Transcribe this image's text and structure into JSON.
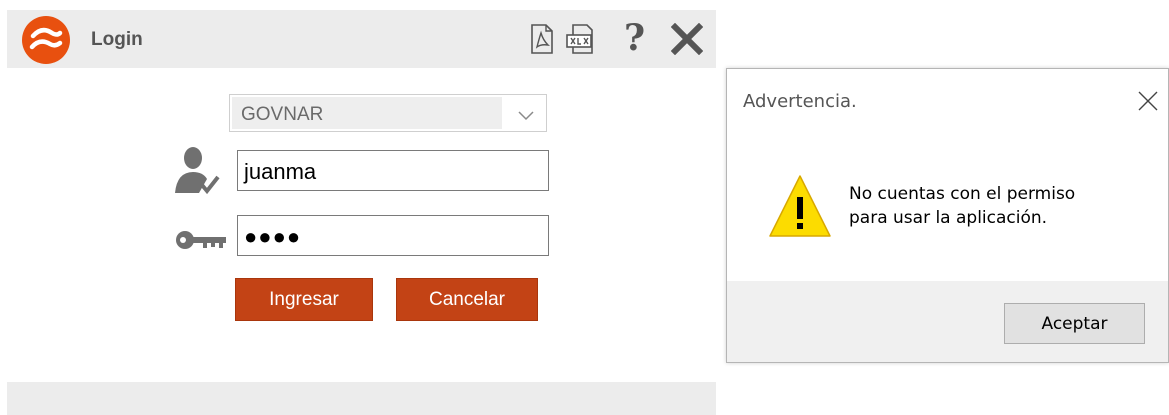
{
  "login": {
    "title": "Login",
    "brand_color": "#e8500f",
    "icons": [
      "app-logo-icon",
      "pdf-icon",
      "document-icon",
      "help-icon",
      "close-icon"
    ],
    "help_glyph": "?",
    "company_select": {
      "value": "GOVNAR"
    },
    "username": {
      "value": "juanma",
      "icon": "user-check-icon"
    },
    "password": {
      "value": "●●●●",
      "icon": "key-icon"
    },
    "buttons": {
      "login_label": "Ingresar",
      "cancel_label": "Cancelar",
      "color": "#c34315"
    }
  },
  "dialog": {
    "title": "Advertencia.",
    "icon": "warning-icon",
    "message_line1": "No cuentas con el permiso",
    "message_line2": "para usar la aplicación.",
    "ok_label": "Aceptar"
  }
}
